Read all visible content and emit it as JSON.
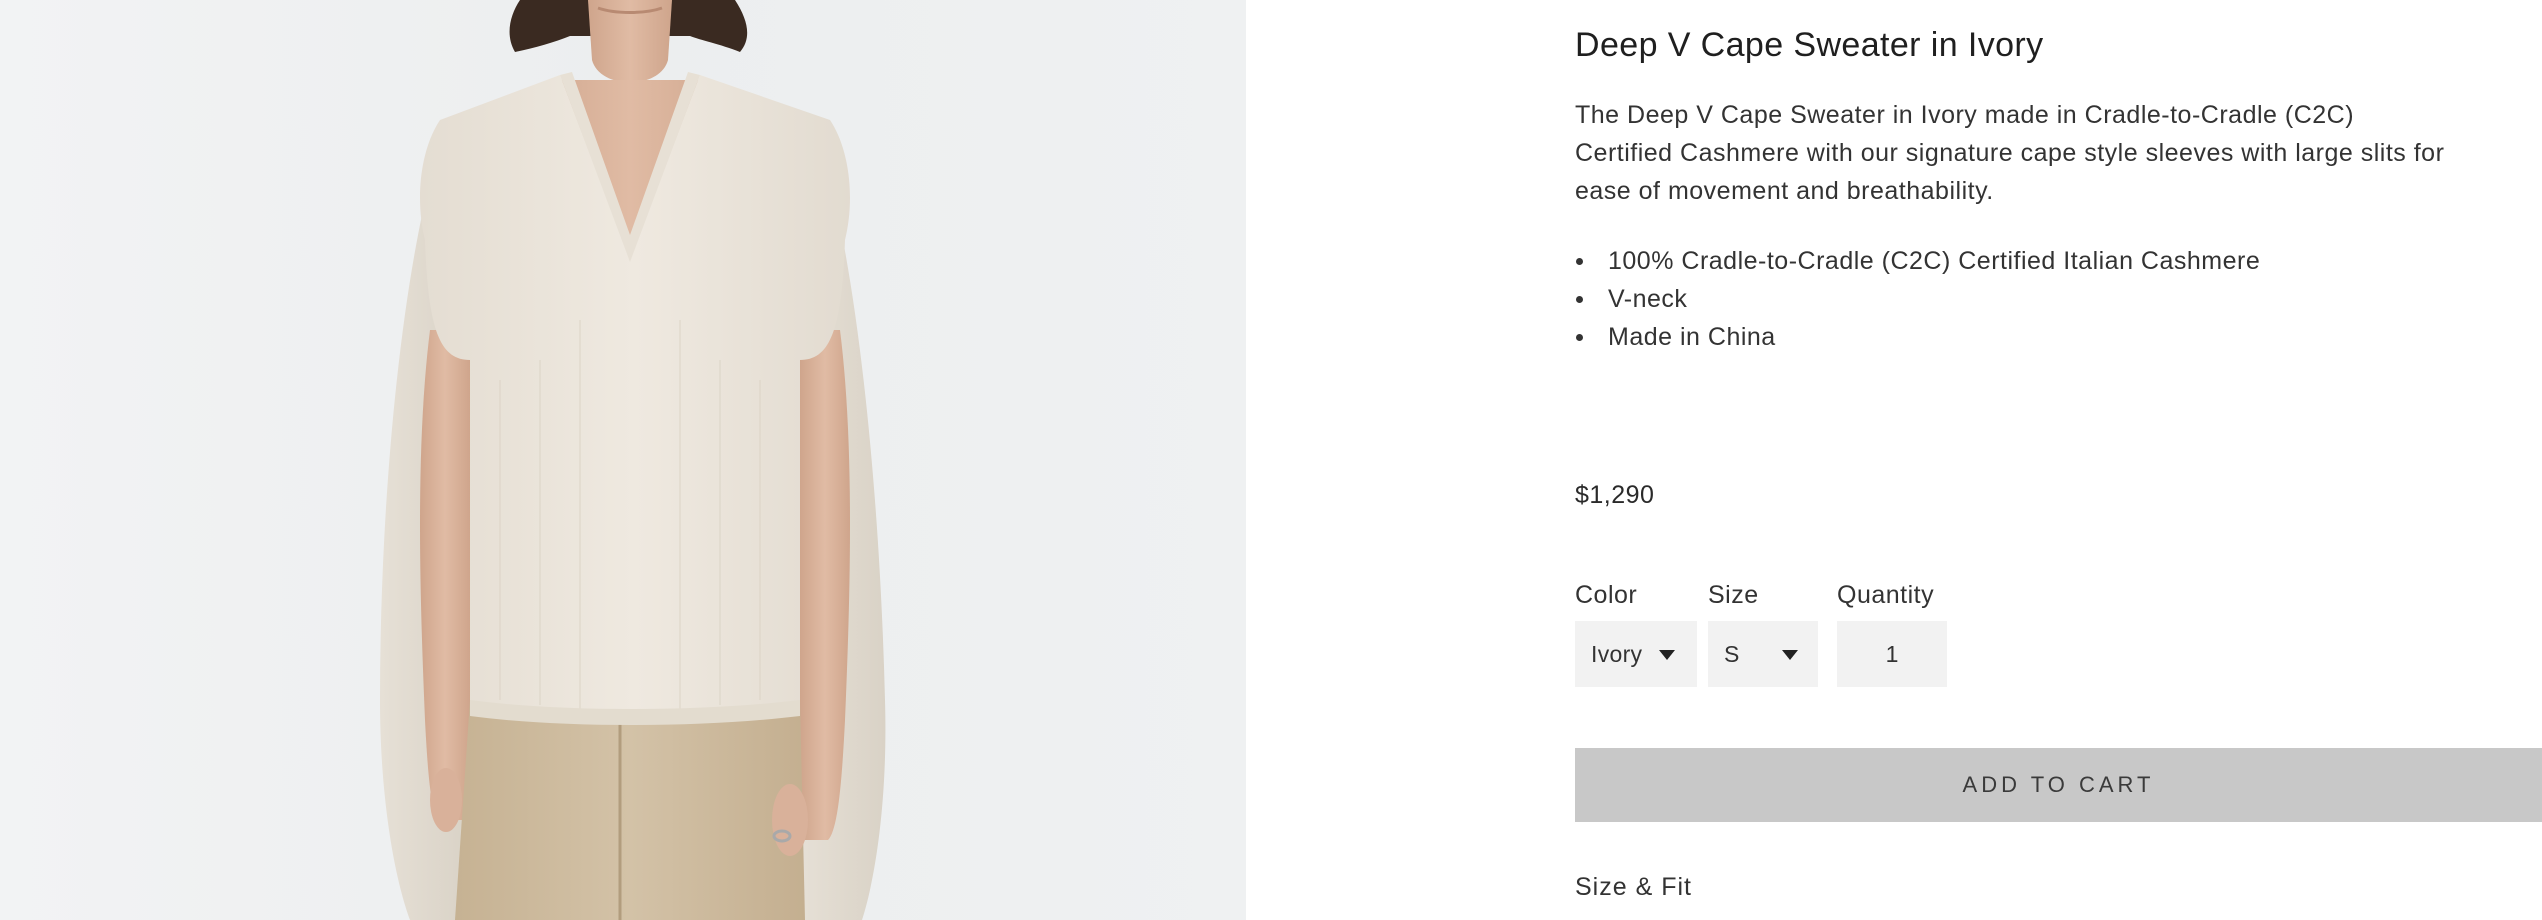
{
  "product": {
    "title": "Deep V Cape Sweater in Ivory",
    "description": "The Deep V Cape Sweater in Ivory made in Cradle-to-Cradle (C2C) Certified Cashmere with our signature cape style sleeves with large slits for ease of movement and breathability.",
    "features": [
      "100% Cradle-to-Cradle (C2C) Certified Italian Cashmere",
      "V-neck",
      "Made in China"
    ],
    "price": "$1,290"
  },
  "options": {
    "color": {
      "label": "Color",
      "value": "Ivory"
    },
    "size": {
      "label": "Size",
      "value": "S"
    },
    "quantity": {
      "label": "Quantity",
      "value": "1"
    }
  },
  "actions": {
    "add_to_cart_label": "ADD TO CART"
  },
  "accordion": {
    "size_fit_label": "Size & Fit"
  },
  "icons": {
    "dropdown": "caret-down-icon"
  },
  "colors": {
    "image_background": "#eef0f1",
    "sweater": "#ece6dd",
    "trousers": "#cdbba0",
    "hair": "#3a2a21",
    "skin": "#dcb49c",
    "button_background": "#c8c8c8",
    "input_background": "#f2f2f2"
  }
}
